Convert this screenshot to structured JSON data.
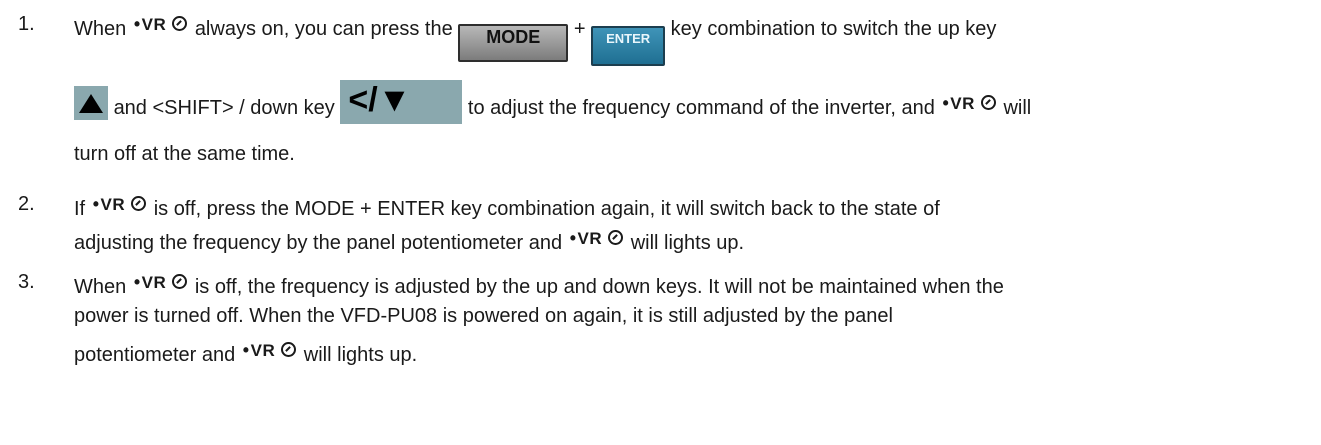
{
  "items": [
    {
      "number": "1.",
      "l1_t1": "When",
      "l1_t2": "always on, you can press the",
      "plus": "+",
      "l1_t3": "key combination to switch the up key",
      "l2_t1": "and <SHIFT> / down key",
      "l2_t2": "to adjust the frequency command of the inverter, and",
      "l2_t3": "will",
      "l3_t1": "turn off at the same time."
    },
    {
      "number": "2.",
      "l1_t1": "If",
      "l1_t2": "is off, press the MODE + ENTER key combination again, it will switch back to the state of",
      "l2_t1": "adjusting the frequency by the panel potentiometer and",
      "l2_t2": "will lights up."
    },
    {
      "number": "3.",
      "l1_t1": "When",
      "l1_t2": "is off, the frequency is adjusted by the up and down keys. It will not be maintained when the",
      "l2_t1": "power is turned off. When the VFD-PU08 is powered on again, it is still adjusted by the panel",
      "l3_t1": "potentiometer and",
      "l3_t2": "will lights up."
    }
  ],
  "indicator": {
    "dot": "•",
    "label": "VR"
  },
  "keys": {
    "mode": "MODE",
    "enter": "ENTER",
    "up_icon": "up-triangle-icon",
    "shift_down": "</▼"
  }
}
